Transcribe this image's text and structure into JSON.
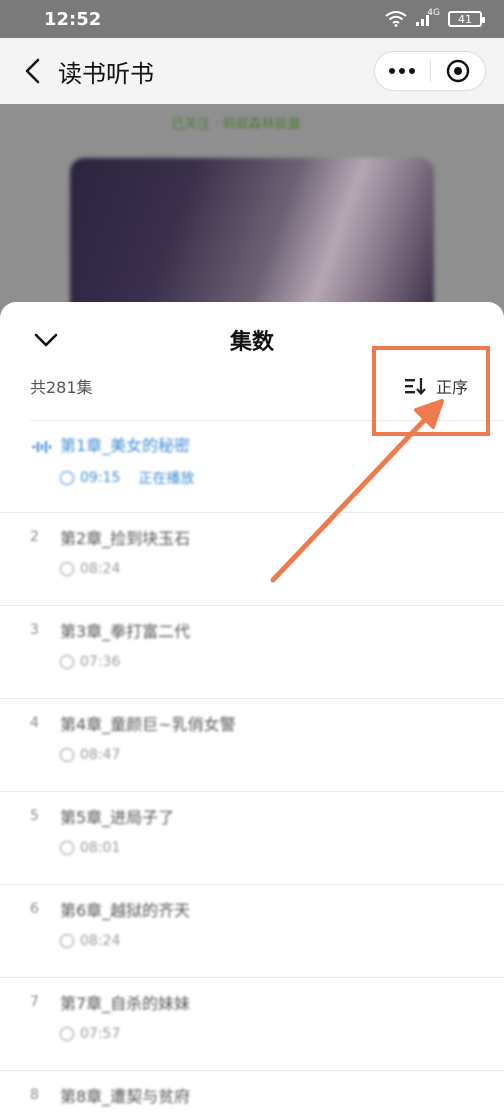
{
  "status": {
    "time": "12:52",
    "network": "4G",
    "battery": "41"
  },
  "header": {
    "title": "读书听书"
  },
  "background": {
    "follow_text": "已关注 · 蚂蚁森林能量"
  },
  "sheet": {
    "title": "集数",
    "count_label": "共281集",
    "order_label": "正序"
  },
  "episodes": [
    {
      "num": "",
      "name": "第1章_美女的秘密",
      "duration": "09:15",
      "status": "正在播放",
      "active": true
    },
    {
      "num": "2",
      "name": "第2章_捡到块玉石",
      "duration": "08:24",
      "status": "",
      "active": false
    },
    {
      "num": "3",
      "name": "第3章_拳打富二代",
      "duration": "07:36",
      "status": "",
      "active": false
    },
    {
      "num": "4",
      "name": "第4章_童颜巨~乳俏女警",
      "duration": "08:47",
      "status": "",
      "active": false
    },
    {
      "num": "5",
      "name": "第5章_进局子了",
      "duration": "08:01",
      "status": "",
      "active": false
    },
    {
      "num": "6",
      "name": "第6章_越狱的齐天",
      "duration": "08:24",
      "status": "",
      "active": false
    },
    {
      "num": "7",
      "name": "第7章_自杀的妹妹",
      "duration": "07:57",
      "status": "",
      "active": false
    },
    {
      "num": "8",
      "name": "第8章_遭契与贫府",
      "duration": "",
      "status": "",
      "active": false
    }
  ],
  "colors": {
    "accent": "#3d8bd8",
    "annotation": "#ee7a4e"
  }
}
